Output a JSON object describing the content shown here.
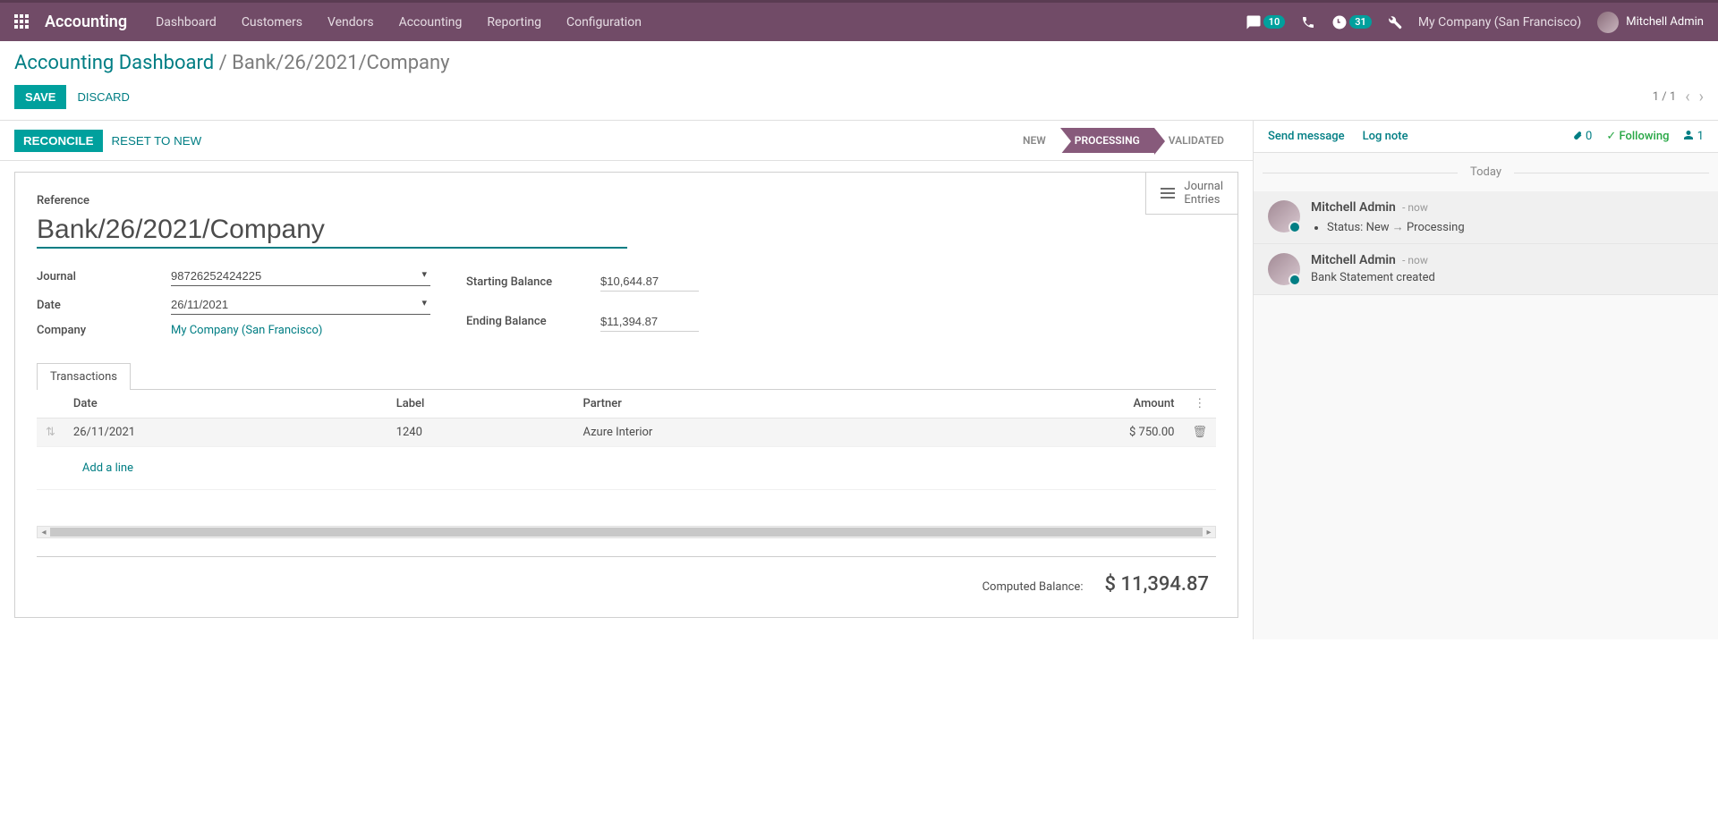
{
  "topbar": {
    "brand": "Accounting",
    "menu": [
      "Dashboard",
      "Customers",
      "Vendors",
      "Accounting",
      "Reporting",
      "Configuration"
    ],
    "msg_badge": "10",
    "activity_badge": "31",
    "company": "My Company (San Francisco)",
    "user": "Mitchell Admin"
  },
  "breadcrumb": {
    "root": "Accounting Dashboard",
    "current": "Bank/26/2021/Company"
  },
  "actions": {
    "save": "SAVE",
    "discard": "DISCARD",
    "pager": "1 / 1"
  },
  "statusbar": {
    "reconcile": "RECONCILE",
    "reset": "RESET TO NEW",
    "states": {
      "new": "NEW",
      "processing": "PROCESSING",
      "validated": "VALIDATED"
    }
  },
  "stat_button": {
    "label": "Journal\nEntries"
  },
  "form": {
    "reference_label": "Reference",
    "reference_value": "Bank/26/2021/Company",
    "journal_label": "Journal",
    "journal_value": "98726252424225",
    "date_label": "Date",
    "date_value": "26/11/2021",
    "company_label": "Company",
    "company_value": "My Company (San Francisco)",
    "start_bal_label": "Starting Balance",
    "start_bal_value": "$10,644.87",
    "end_bal_label": "Ending Balance",
    "end_bal_value": "$11,394.87"
  },
  "tabs": {
    "transactions": "Transactions"
  },
  "table": {
    "headers": {
      "date": "Date",
      "label": "Label",
      "partner": "Partner",
      "amount": "Amount"
    },
    "rows": [
      {
        "date": "26/11/2021",
        "label": "1240",
        "partner": "Azure Interior",
        "amount": "$ 750.00"
      }
    ],
    "add_line": "Add a line"
  },
  "computed": {
    "label": "Computed Balance:",
    "value": "$ 11,394.87"
  },
  "chatter": {
    "send": "Send message",
    "log": "Log note",
    "attach_count": "0",
    "following": "Following",
    "followers": "1",
    "today": "Today",
    "messages": [
      {
        "author": "Mitchell Admin",
        "time": "- now",
        "status_prefix": "Status:",
        "status_from": "New",
        "status_to": "Processing"
      },
      {
        "author": "Mitchell Admin",
        "time": "- now",
        "body": "Bank Statement created"
      }
    ]
  }
}
